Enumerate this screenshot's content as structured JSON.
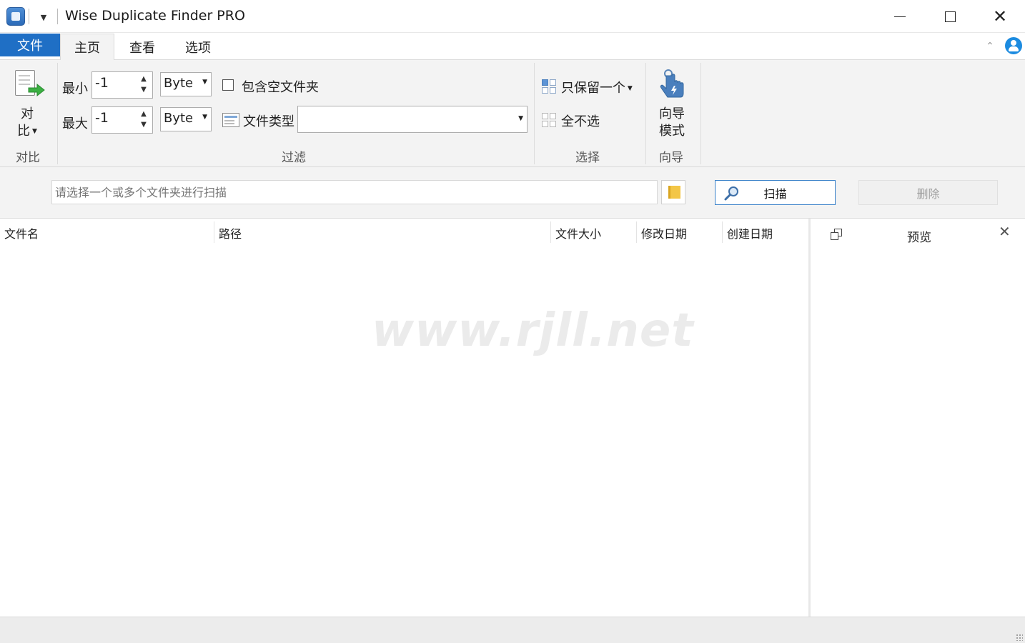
{
  "window": {
    "title": "Wise Duplicate Finder PRO"
  },
  "tabs": {
    "file": "文件",
    "home": "主页",
    "view": "查看",
    "options": "选项"
  },
  "ribbon": {
    "compare": {
      "label_line1": "对",
      "label_line2": "比",
      "group": "对比"
    },
    "filter": {
      "min_label": "最小",
      "min_value": "-1",
      "min_unit": "Byte",
      "max_label": "最大",
      "max_value": "-1",
      "max_unit": "Byte",
      "include_empty_label": "包含空文件夹",
      "filetype_label": "文件类型",
      "filetype_value": "",
      "group": "过滤"
    },
    "select": {
      "keep_one": "只保留一个",
      "select_none": "全不选",
      "group": "选择"
    },
    "wizard": {
      "label_line1": "向导",
      "label_line2": "模式",
      "group": "向导"
    }
  },
  "pathbar": {
    "placeholder": "请选择一个或多个文件夹进行扫描",
    "scan": "扫描",
    "delete": "删除"
  },
  "table": {
    "columns": [
      "文件名",
      "路径",
      "文件大小",
      "修改日期",
      "创建日期"
    ]
  },
  "preview": {
    "title": "预览"
  },
  "watermark": "www.rjll.net",
  "colors": {
    "accent": "#1f6fc5",
    "ribbon_bg": "#f3f3f3"
  }
}
